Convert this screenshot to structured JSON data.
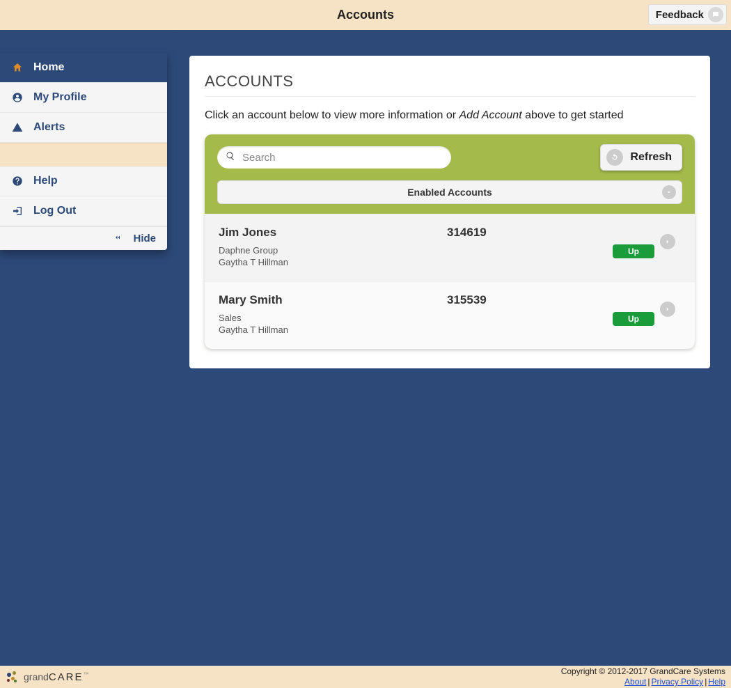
{
  "header": {
    "title": "Accounts",
    "feedback_label": "Feedback"
  },
  "sidebar": {
    "items": [
      {
        "label": "Home",
        "active": true
      },
      {
        "label": "My Profile",
        "active": false
      },
      {
        "label": "Alerts",
        "active": false
      }
    ],
    "items2": [
      {
        "label": "Help"
      },
      {
        "label": "Log Out"
      }
    ],
    "hide_label": "Hide"
  },
  "main": {
    "heading": "ACCOUNTS",
    "intro_pre": "Click an account below to view more information or ",
    "intro_em": "Add Account",
    "intro_post": " above to get started",
    "search_placeholder": "Search",
    "refresh_label": "Refresh",
    "filter_label": "Enabled Accounts",
    "accounts": [
      {
        "name": "Jim Jones",
        "id": "314619",
        "group": "Daphne Group",
        "owner": "Gaytha T Hillman",
        "status": "Up"
      },
      {
        "name": "Mary Smith",
        "id": "315539",
        "group": "Sales",
        "owner": "Gaytha T Hillman",
        "status": "Up"
      }
    ]
  },
  "footer": {
    "brand_small": "grand",
    "brand_big": "CARE",
    "copyright": "Copyright © 2012-2017 GrandCare Systems",
    "links": {
      "about": "About",
      "privacy": "Privacy Policy",
      "help": "Help"
    }
  }
}
